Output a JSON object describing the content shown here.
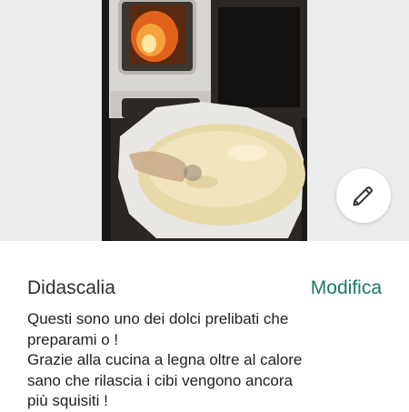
{
  "caption": {
    "title": "Didascalia",
    "edit_label": "Modifica",
    "text": "Questi sono uno dei dolci prelibati che\npreparami o !\nGrazie alla cucina a legna oltre al calore\nsano che rilascia i cibi vengono ancora\npiù squisiti !"
  },
  "photo": {
    "subject": "cake baking on wood-burning stove",
    "edit_icon": "pencil-icon"
  },
  "colors": {
    "accent": "#1a7a6a",
    "background": "#ececec"
  }
}
